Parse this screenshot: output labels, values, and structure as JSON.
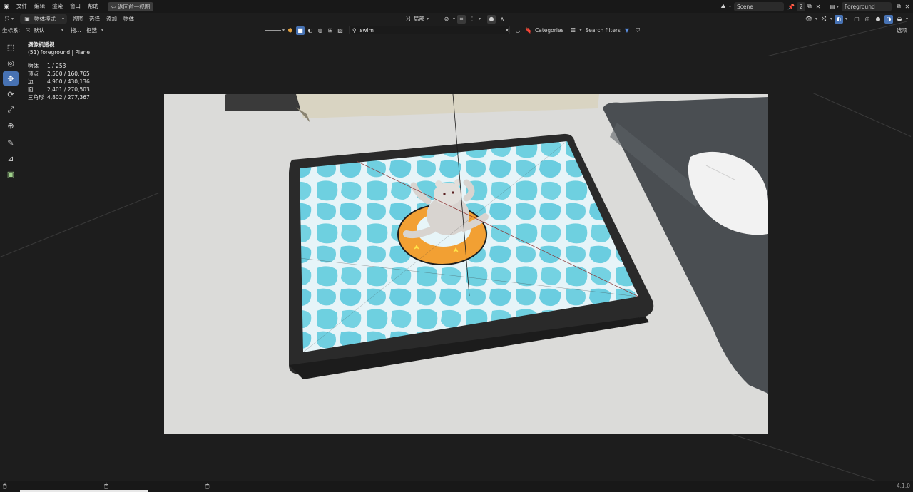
{
  "menubar": {
    "items": [
      "文件",
      "编辑",
      "渲染",
      "窗口",
      "帮助"
    ],
    "back_button": "返回前一视图",
    "scene": "Scene",
    "scene_users": "2",
    "view_layer": "Foreground"
  },
  "toolbar": {
    "mode": "物体模式",
    "view": "视图",
    "select": "选择",
    "add": "添加",
    "object": "物体",
    "pivot": "局部"
  },
  "toolbar2": {
    "coord_label": "坐标系:",
    "coord_value": "默认",
    "drag": "拖...",
    "select_mode": "框选",
    "search_value": "swim",
    "categories": "Categories",
    "search_filters": "Search filters",
    "options": "选项"
  },
  "tools": [
    {
      "name": "select-box-tool",
      "glyph": "⬚"
    },
    {
      "name": "cursor-tool",
      "glyph": "◎"
    },
    {
      "name": "move-tool",
      "glyph": "✥"
    },
    {
      "name": "rotate-tool",
      "glyph": "⟳"
    },
    {
      "name": "scale-tool",
      "glyph": "⤢"
    },
    {
      "name": "transform-tool",
      "glyph": "⊕"
    },
    {
      "name": "annotate-tool",
      "glyph": "✎"
    },
    {
      "name": "measure-tool",
      "glyph": "📐"
    },
    {
      "name": "add-cube-tool",
      "glyph": "▣"
    }
  ],
  "overlay": {
    "title": "摄像机透视",
    "subtitle": "(51) foreground | Plane",
    "stats": [
      {
        "k": "物体",
        "v": "1 / 253"
      },
      {
        "k": "顶点",
        "v": "2,500 / 160,765"
      },
      {
        "k": "边",
        "v": "4,900 / 430,136"
      },
      {
        "k": "面",
        "v": "2,401 / 270,503"
      },
      {
        "k": "三角形",
        "v": "4,802 / 277,367"
      }
    ]
  },
  "status": {
    "version": "4.1.0",
    "progress": 1.0
  },
  "colors": {
    "accent": "#4772b3",
    "water": "#6ed0e0",
    "float_ring": "#f2a033"
  }
}
